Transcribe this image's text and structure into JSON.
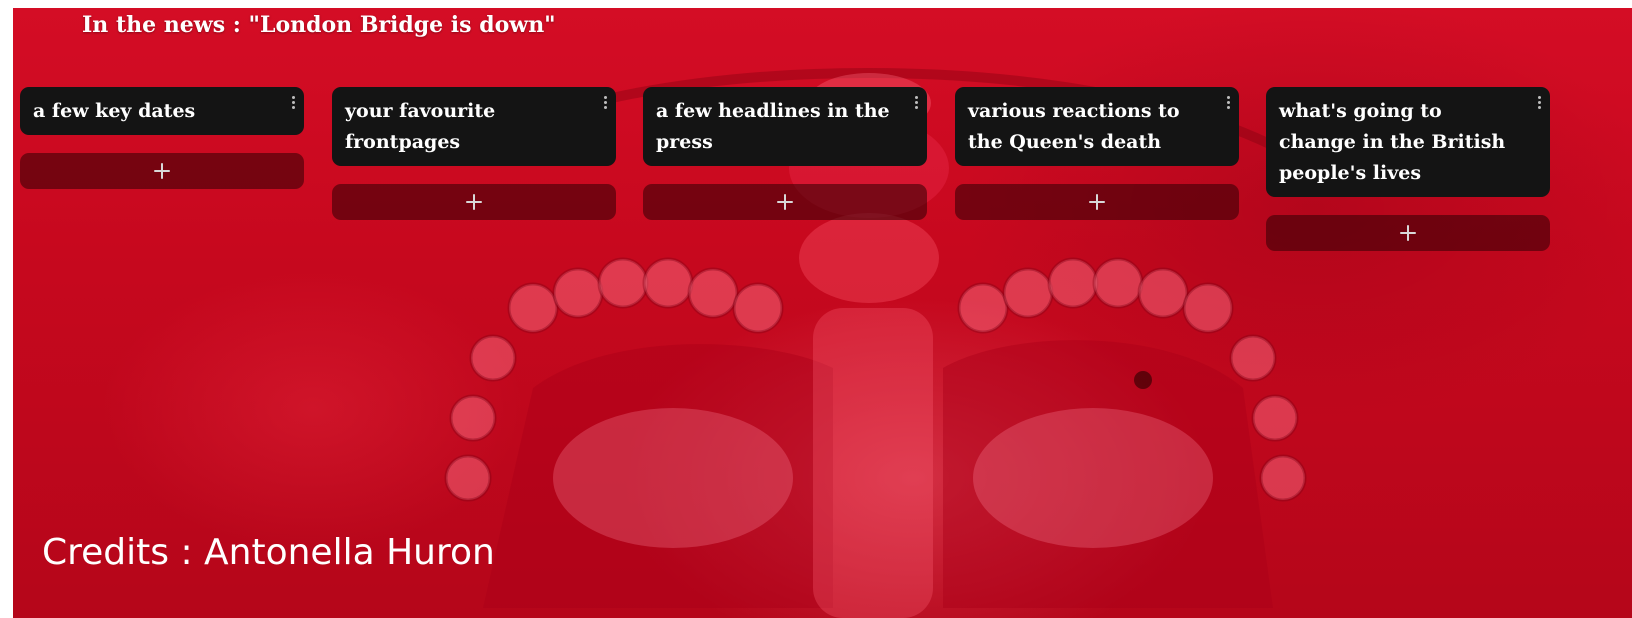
{
  "board": {
    "title": "In the news : \"London Bridge is down\""
  },
  "columns": [
    {
      "title": "a few key dates"
    },
    {
      "title": "your favourite frontpages"
    },
    {
      "title": "a few headlines in the press"
    },
    {
      "title": "various reactions to the Queen's death"
    },
    {
      "title": "what's going to change in the British people's lives"
    }
  ],
  "add_button_icon": "plus-icon",
  "menu_icon": "kebab-icon",
  "credits": "Credits : Antonella Huron",
  "colors": {
    "background": "#c7081e",
    "card": "#141414",
    "add_button": "#37000594",
    "text": "#ffffff"
  }
}
